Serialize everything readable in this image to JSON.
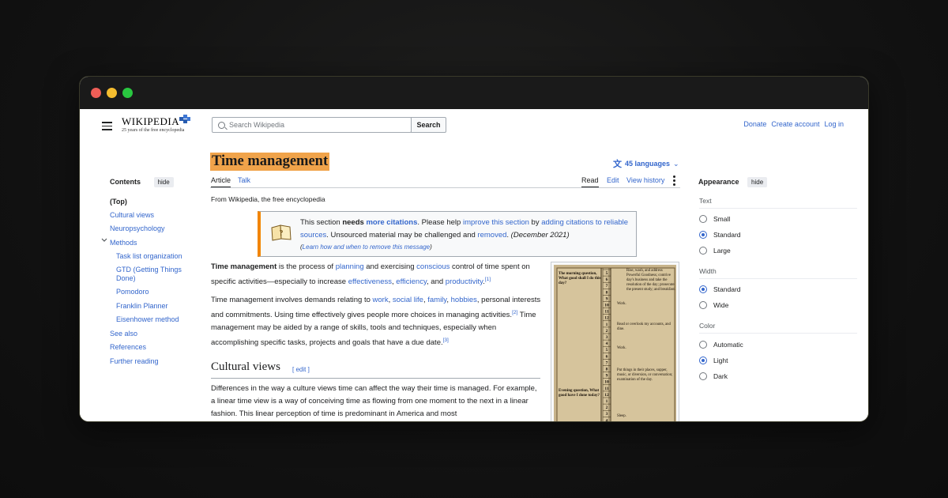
{
  "header": {
    "logo_title": "WIKIPEDIA",
    "logo_sub": "25 years of the free encyclopedia",
    "search_placeholder": "Search Wikipedia",
    "search_button": "Search",
    "links": [
      "Donate",
      "Create account",
      "Log in"
    ]
  },
  "toc": {
    "title": "Contents",
    "hide": "hide",
    "items": [
      "(Top)",
      "Cultural views",
      "Neuropsychology",
      "Methods",
      "Task list organization",
      "GTD (Getting Things Done)",
      "Pomodoro",
      "Franklin Planner",
      "Eisenhower method",
      "See also",
      "References",
      "Further reading"
    ]
  },
  "article": {
    "title": "Time management",
    "languages": "45 languages",
    "tab_article": "Article",
    "tab_talk": "Talk",
    "tab_read": "Read",
    "tab_edit": "Edit",
    "tab_history": "View history",
    "from": "From Wikipedia, the free encyclopedia",
    "notice": {
      "t1": "This section ",
      "needs": "needs",
      "more_citations": "more citations",
      "t2": ". Please help ",
      "improve": "improve this section",
      "t3": " by ",
      "adding": "adding citations to reliable sources",
      "t4": ". Unsourced material may be challenged and ",
      "removed": "removed",
      "t5": ".",
      "date": " (December 2021)",
      "learn_open": "(",
      "learn": "Learn how and when to remove this message",
      "learn_close": ")"
    },
    "p1": {
      "bold": "Time management",
      "a": " is the process of ",
      "planning": "planning",
      "b": " and exercising ",
      "conscious": "conscious",
      "c": " control of time spent on specific activities—especially to increase ",
      "effectiveness": "effectiveness",
      "d": ", ",
      "efficiency": "efficiency",
      "e": ", and ",
      "productivity": "productivity",
      "f": ".",
      "ref": "[1]"
    },
    "p2": {
      "a": "Time management involves demands relating to ",
      "work": "work",
      "b": ", ",
      "social": "social life",
      "c": ", ",
      "family": "family",
      "d": ", ",
      "hobbies": "hobbies",
      "e": ", personal interests and commitments. Using time effectively gives people more choices in managing activities.",
      "ref2": "[2]",
      "f": " Time management may be aided by a range of skills, tools and techniques, especially when accomplishing specific tasks, projects and goals that have a due date.",
      "ref3": "[3]"
    },
    "h2": "Cultural views",
    "edit": "[ edit ]",
    "p3": "Differences in the way a culture views time can affect the way their time is managed. For example, a linear time view is a way of conceiving time as flowing from one moment to the next in a linear fashion. This linear perception of time is predominant in America and most"
  },
  "figure": {
    "morning": "The morning question, What good shall I do this day?",
    "rise": "Rise, wash, and address Powerful Goodness; contrive day's business and take the resolution of the day; prosecute the present study; and breakfast.",
    "work1": "Work.",
    "read": "Read or overlook my accounts, and dine.",
    "work2": "Work.",
    "put": "Put things in their places, supper, music, or diversion, or conversation; examination of the day.",
    "evening": "Evening question, What good have I done today?",
    "sleep": "Sleep.",
    "hours": [
      "5",
      "6",
      "7",
      "8",
      "9",
      "10",
      "11",
      "12",
      "1",
      "2",
      "3",
      "4",
      "5",
      "6",
      "7",
      "8",
      "9",
      "10",
      "11",
      "12",
      "1",
      "2",
      "3",
      "4"
    ]
  },
  "appearance": {
    "title": "Appearance",
    "hide": "hide",
    "text_label": "Text",
    "text_options": [
      "Small",
      "Standard",
      "Large"
    ],
    "text_selected": 1,
    "width_label": "Width",
    "width_options": [
      "Standard",
      "Wide"
    ],
    "width_selected": 0,
    "color_label": "Color",
    "color_options": [
      "Automatic",
      "Light",
      "Dark"
    ],
    "color_selected": 1
  }
}
